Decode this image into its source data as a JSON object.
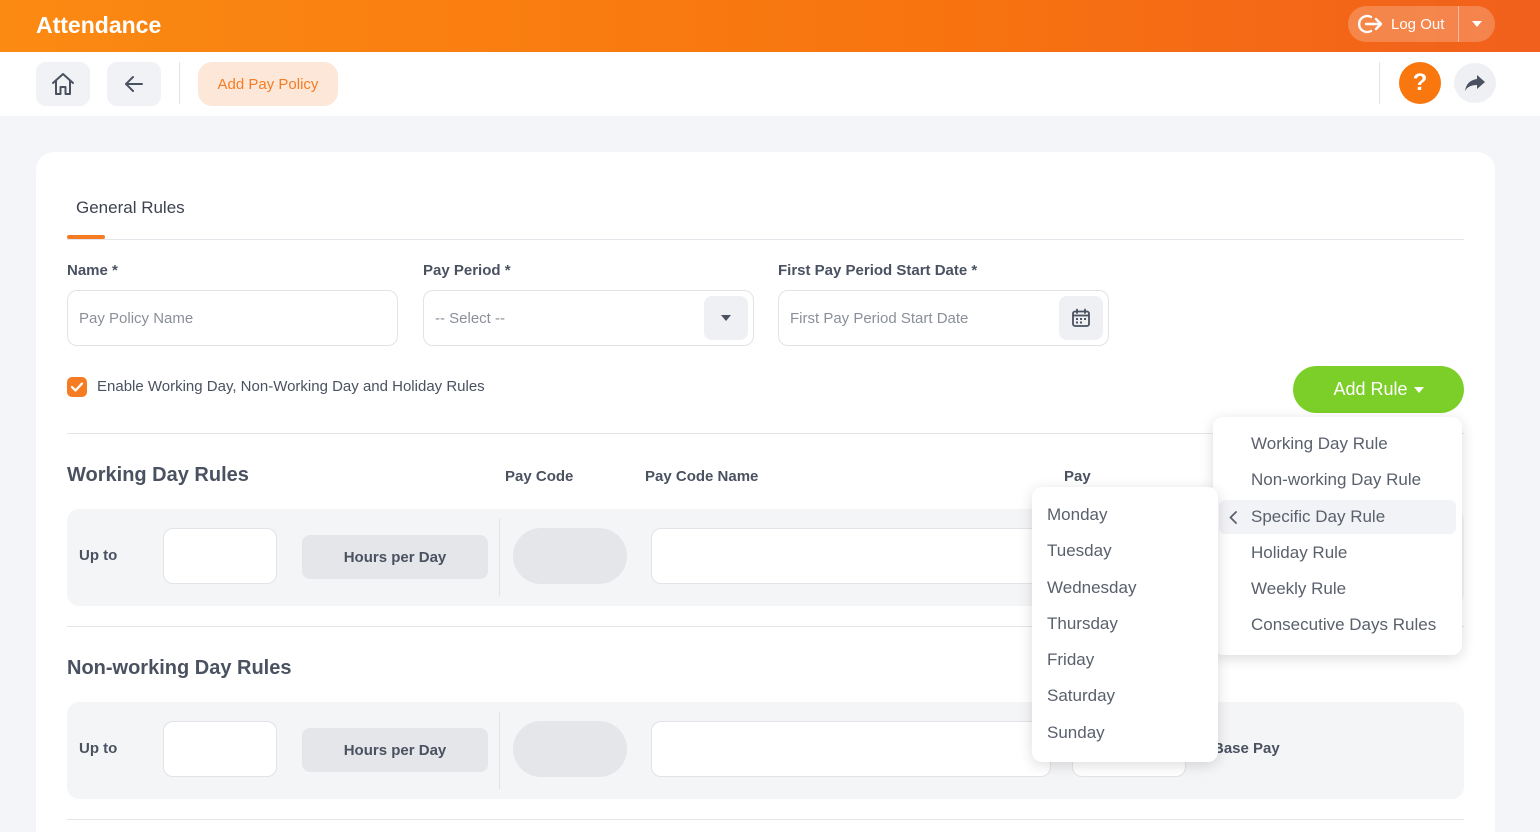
{
  "header": {
    "app_title": "Attendance",
    "logout_label": "Log Out",
    "brand_color": "#f8770f"
  },
  "toolbar": {
    "breadcrumb_label": "Add Pay Policy",
    "help_label": "?"
  },
  "tabs": [
    {
      "label": "General Rules",
      "active": true
    }
  ],
  "form": {
    "name": {
      "label": "Name *",
      "placeholder": "Pay Policy Name"
    },
    "pay_period": {
      "label": "Pay Period *",
      "selected": "-- Select --"
    },
    "first_start_date": {
      "label": "First Pay Period Start Date *",
      "placeholder": "First Pay Period Start Date"
    },
    "enable_rules": {
      "label": "Enable Working Day, Non-Working Day and Holiday Rules",
      "checked": true
    },
    "add_rule_label": "Add Rule",
    "add_rule_color": "#7ccf28"
  },
  "columns": {
    "pay_code": "Pay Code",
    "pay_code_name": "Pay Code Name",
    "pay": "Pay"
  },
  "sections": {
    "working_day": {
      "title": "Working Day Rules",
      "row": {
        "prefix": "Up to",
        "unit": "Hours per Day"
      }
    },
    "non_working_day": {
      "title": "Non-working Day Rules",
      "row": {
        "prefix": "Up to",
        "unit": "Hours per Day",
        "base_pay": "Base Pay"
      }
    }
  },
  "rule_menu": {
    "items": [
      "Working Day Rule",
      "Non-working Day Rule",
      "Specific Day Rule",
      "Holiday Rule",
      "Weekly Rule",
      "Consecutive Days Rules"
    ],
    "active_item": "Specific Day Rule"
  },
  "day_submenu": {
    "items": [
      "Monday",
      "Tuesday",
      "Wednesday",
      "Thursday",
      "Friday",
      "Saturday",
      "Sunday"
    ]
  }
}
